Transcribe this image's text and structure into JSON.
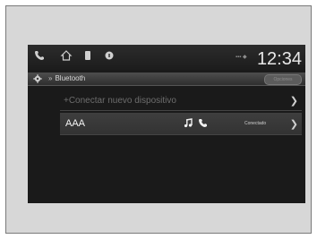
{
  "status_bar": {
    "icons": [
      {
        "name": "phone-icon",
        "label": ""
      },
      {
        "name": "home-icon",
        "label": ""
      },
      {
        "name": "device-icon",
        "label": ""
      },
      {
        "name": "info-icon",
        "label": ""
      }
    ],
    "signal": "▪▪▪ ◆",
    "clock": "12:34"
  },
  "header": {
    "breadcrumb_arrow": "»",
    "breadcrumb": "Bluetooth",
    "button_label": "Opciones"
  },
  "list": {
    "connect_label": "+Conectar nuevo dispositivo",
    "device": {
      "name": "AAA",
      "status": "Conectado"
    }
  },
  "colors": {
    "screen_bg": "#1a1a1a",
    "frame_bg": "#d7d7d7",
    "header_bg": "#3a3a3a"
  }
}
